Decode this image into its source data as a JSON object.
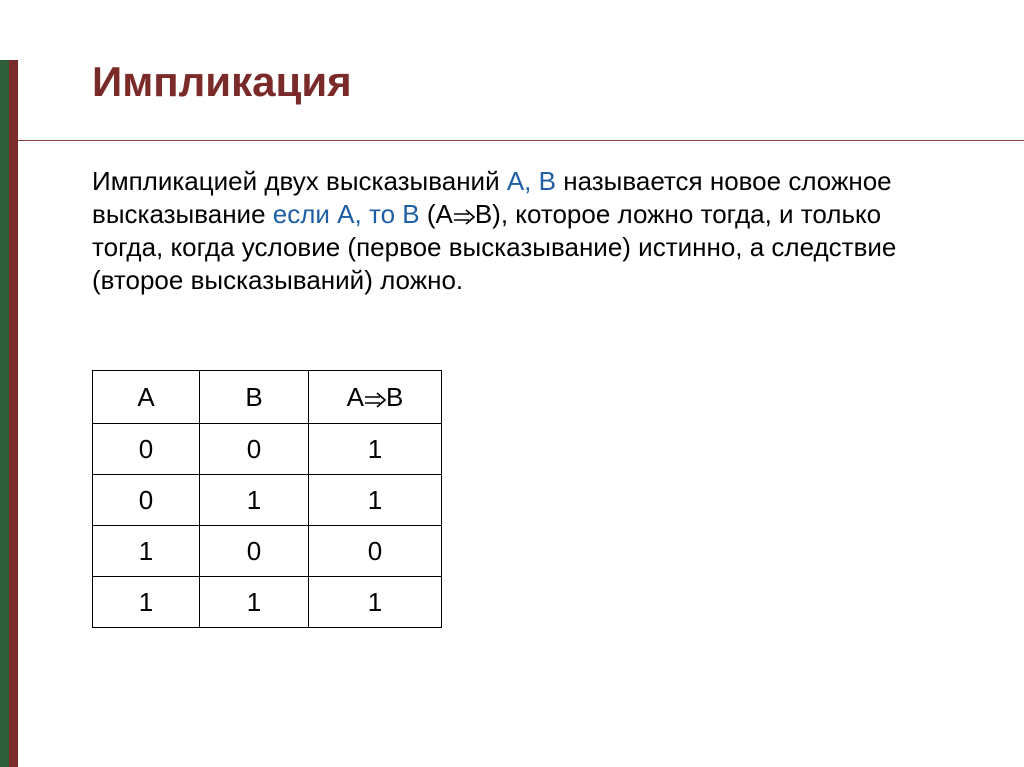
{
  "title": "Импликация",
  "paragraph": {
    "p1_a": "Импликацией двух высказываний ",
    "p1_b": "А, В",
    "p1_c": " называется новое сложное высказывание ",
    "p1_d": "если А, то В",
    "p1_e": " (A",
    "p1_f": "B), которое ложно тогда, и только тогда, когда условие (первое высказывание) истинно, а следствие (второе высказываний) ложно."
  },
  "table": {
    "headers": {
      "a": "A",
      "b": "B",
      "r_left": "A",
      "r_right": "B"
    },
    "rows": [
      {
        "a": "0",
        "b": "0",
        "r": "1"
      },
      {
        "a": "0",
        "b": "1",
        "r": "1"
      },
      {
        "a": "1",
        "b": "0",
        "r": "0"
      },
      {
        "a": "1",
        "b": "1",
        "r": "1"
      }
    ]
  }
}
